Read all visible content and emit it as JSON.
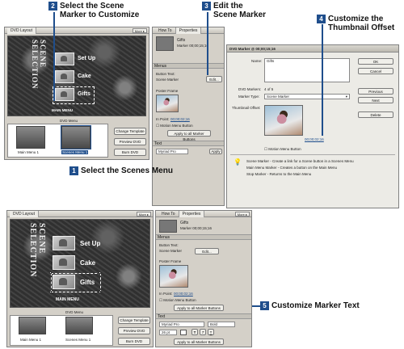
{
  "callouts": {
    "c1": {
      "num": "1",
      "text": "Select the Scenes Menu"
    },
    "c2": {
      "num": "2",
      "line1": "Select the Scene",
      "line2": "Marker to Customize"
    },
    "c3": {
      "num": "3",
      "line1": "Edit the",
      "line2": "Scene Marker"
    },
    "c4": {
      "num": "4",
      "line1": "Customize the",
      "line2": "Thumbnail Offset"
    },
    "c5": {
      "num": "5",
      "text": "Customize Marker Text"
    }
  },
  "layout_panel": {
    "title": "DVD Layout",
    "more": "More ▸",
    "vertical_title": "SCENE SELECTION",
    "items": [
      "Set Up",
      "Cake",
      "Gifts"
    ],
    "main_menu_label": "MAIN MENU",
    "dvd_menu_label": "DVD Menu",
    "menu_thumbs": [
      "Main Menu 1",
      "Scenes Menu 1"
    ],
    "buttons": {
      "change_template": "Change Template",
      "preview_dvd": "Preview DVD",
      "burn_dvd": "Burn DVD"
    }
  },
  "properties_panel": {
    "tabs": [
      "How To",
      "Properties"
    ],
    "more": "More ▸",
    "item_name": "Gifts",
    "item_sub": "Marker 00;00;15;16",
    "menus_section": "Menus",
    "button_text_label": "Button Text:",
    "button_text_value": "Scene Marker",
    "edit_button": "Edit...",
    "poster_frame_label": "Poster Frame",
    "inpoint_label": "In Point:",
    "inpoint_value": "00;00;02;16",
    "motion_menu_button": "Motion Menu Button",
    "apply_all": "Apply to all Marker Buttons",
    "text_section": "Text",
    "font_family": "Myriad Pro",
    "font_style": "Bold",
    "font_size": "26 pt",
    "style_buttons": [
      "T",
      "T",
      "T"
    ],
    "apply_label": "Apply"
  },
  "dialog": {
    "title": "DVD Marker @ 00;00;15;16",
    "name_label": "Name:",
    "name_value": "Gifts",
    "ok": "OK",
    "cancel": "Cancel",
    "previous": "Previous",
    "next": "Next",
    "delete": "Delete",
    "dvd_markers_label": "DVD Markers:",
    "dvd_markers_value": "4 of 5",
    "marker_type_label": "Marker Type:",
    "marker_type_value": "Scene Marker",
    "thumb_offset_label": "Thumbnail Offset:",
    "thumb_offset_value": "00;00;02;16",
    "motion_menu_button": "Motion Menu Button",
    "info": [
      "Scene Marker - Create a link for a Scene button in a Scenes Menu",
      "Main Menu Marker - Creates a button on the Main Menu",
      "Stop Marker - Returns to the Main Menu"
    ]
  }
}
